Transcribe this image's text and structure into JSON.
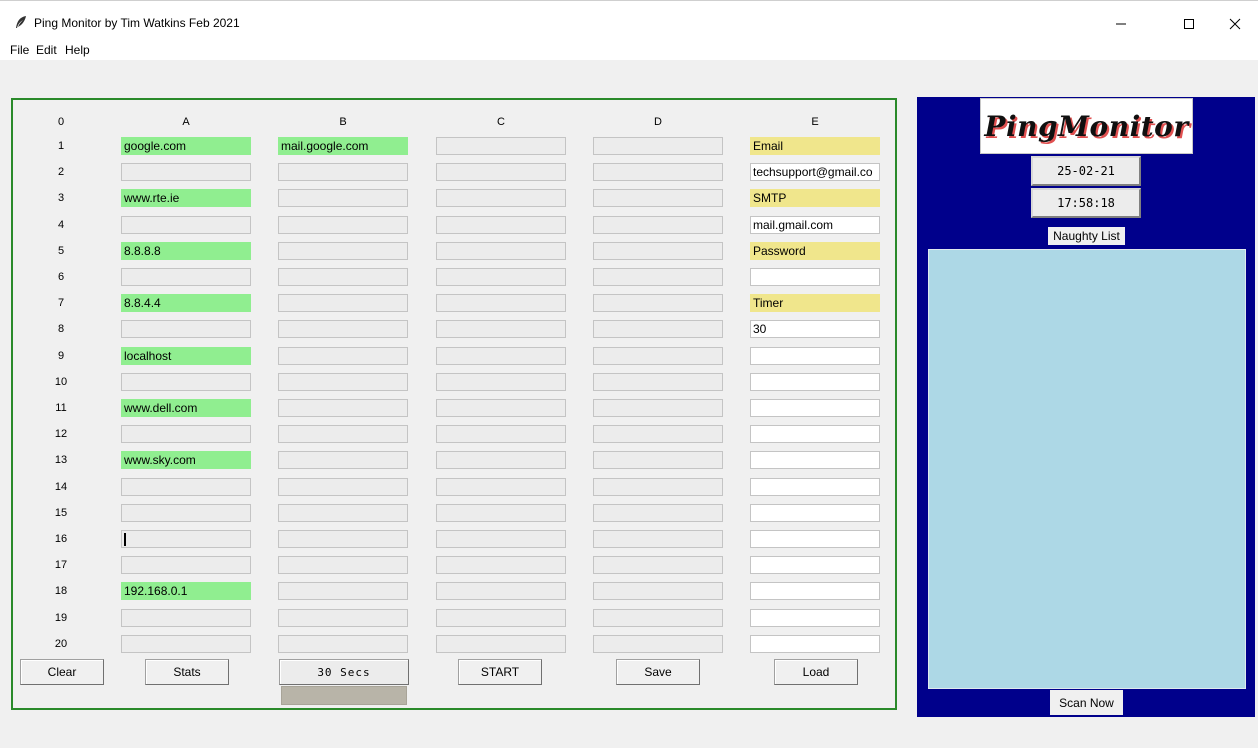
{
  "window": {
    "title": "Ping Monitor by Tim Watkins Feb 2021"
  },
  "menu": [
    "File",
    "Edit",
    "Help"
  ],
  "sheet": {
    "corner": "0",
    "columns": [
      "A",
      "B",
      "C",
      "D",
      "E"
    ],
    "rows": [
      {
        "num": "1",
        "cells": [
          "google.com",
          "mail.google.com",
          "",
          "",
          "Email"
        ]
      },
      {
        "num": "2",
        "cells": [
          "",
          "",
          "",
          "",
          "techsupport@gmail.co"
        ]
      },
      {
        "num": "3",
        "cells": [
          "www.rte.ie",
          "",
          "",
          "",
          "SMTP"
        ]
      },
      {
        "num": "4",
        "cells": [
          "",
          "",
          "",
          "",
          "mail.gmail.com"
        ]
      },
      {
        "num": "5",
        "cells": [
          "8.8.8.8",
          "",
          "",
          "",
          "Password"
        ]
      },
      {
        "num": "6",
        "cells": [
          "",
          "",
          "",
          "",
          ""
        ]
      },
      {
        "num": "7",
        "cells": [
          "8.8.4.4",
          "",
          "",
          "",
          "Timer"
        ]
      },
      {
        "num": "8",
        "cells": [
          "",
          "",
          "",
          "",
          "30"
        ]
      },
      {
        "num": "9",
        "cells": [
          "localhost",
          "",
          "",
          "",
          ""
        ]
      },
      {
        "num": "10",
        "cells": [
          "",
          "",
          "",
          "",
          ""
        ]
      },
      {
        "num": "11",
        "cells": [
          "www.dell.com",
          "",
          "",
          "",
          ""
        ]
      },
      {
        "num": "12",
        "cells": [
          "",
          "",
          "",
          "",
          ""
        ]
      },
      {
        "num": "13",
        "cells": [
          "www.sky.com",
          "",
          "",
          "",
          ""
        ]
      },
      {
        "num": "14",
        "cells": [
          "",
          "",
          "",
          "",
          ""
        ]
      },
      {
        "num": "15",
        "cells": [
          "",
          "",
          "",
          "",
          ""
        ]
      },
      {
        "num": "16",
        "cells": [
          "",
          "",
          "",
          "",
          ""
        ]
      },
      {
        "num": "17",
        "cells": [
          "",
          "",
          "",
          "",
          ""
        ]
      },
      {
        "num": "18",
        "cells": [
          "192.168.0.1",
          "",
          "",
          "",
          ""
        ]
      },
      {
        "num": "19",
        "cells": [
          "",
          "",
          "",
          "",
          ""
        ]
      },
      {
        "num": "20",
        "cells": [
          "",
          "",
          "",
          "",
          ""
        ]
      }
    ]
  },
  "buttons": {
    "clear": "Clear",
    "stats": "Stats",
    "timer": "30 Secs",
    "start": "START",
    "save": "Save",
    "load": "Load"
  },
  "progress": {
    "fraction": 0
  },
  "side": {
    "logo": "PingMonitor",
    "date": "25-02-21",
    "time": "17:58:18",
    "naughty_label": "Naughty List",
    "scan_button": "Scan Now"
  },
  "colors": {
    "host_cell": "#90ee90",
    "settings_label": "#f0e68c",
    "panel_bg": "#00008b",
    "naughty_list_bg": "#add8e6",
    "frame_border": "#2a8a2a"
  },
  "icons": {
    "app": "feather-icon",
    "minimize": "minimize-icon",
    "maximize": "maximize-icon",
    "close": "close-icon"
  }
}
